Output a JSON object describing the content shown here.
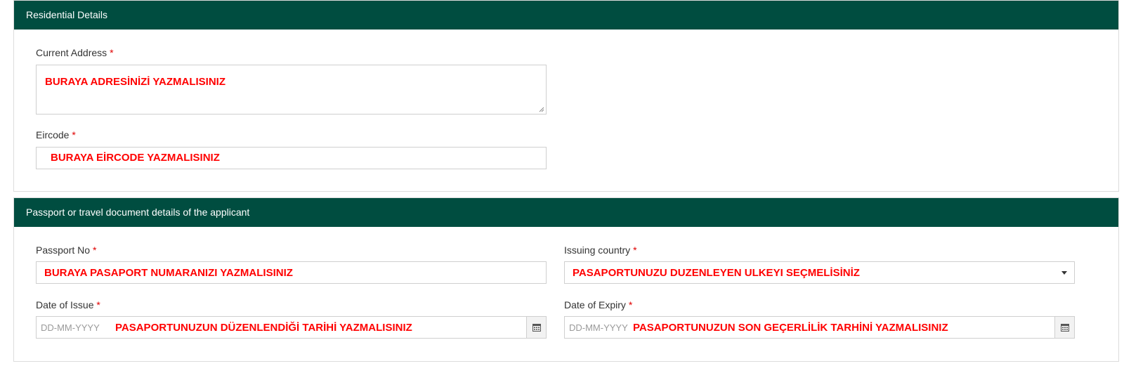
{
  "residential": {
    "header": "Residential Details",
    "address": {
      "label": "Current Address",
      "required_mark": "*",
      "value": "BURAYA ADRESİNİZİ YAZMALISINIZ"
    },
    "eircode": {
      "label": "Eircode",
      "required_mark": "*",
      "value": "BURAYA EİRCODE YAZMALISINIZ"
    }
  },
  "passport": {
    "header": "Passport or travel document details of the applicant",
    "passport_no": {
      "label": "Passport No",
      "required_mark": "*",
      "value": "BURAYA PASAPORT NUMARANIZI YAZMALISINIZ"
    },
    "issuing_country": {
      "label": "Issuing country",
      "required_mark": "*",
      "value": "PASAPORTUNUZU DUZENLEYEN ULKEYI SEÇMELİSİNİZ"
    },
    "date_of_issue": {
      "label": "Date of Issue",
      "required_mark": "*",
      "placeholder": "DD-MM-YYYY",
      "value": "PASAPORTUNUZUN DÜZENLENDİĞİ TARİHİ YAZMALISINIZ"
    },
    "date_of_expiry": {
      "label": "Date of Expiry",
      "required_mark": "*",
      "placeholder": "DD-MM-YYYY",
      "value": "PASAPORTUNUZUN SON GEÇERLİLİK TARHİNİ YAZMALISINIZ"
    }
  },
  "icons": {
    "calendar": "calendar-icon",
    "dropdown": "chevron-down-icon",
    "resize": "resize-handle-icon"
  },
  "colors": {
    "header_bg": "#004d40",
    "annotation_red": "#ff0000",
    "required_red": "#e00000"
  }
}
